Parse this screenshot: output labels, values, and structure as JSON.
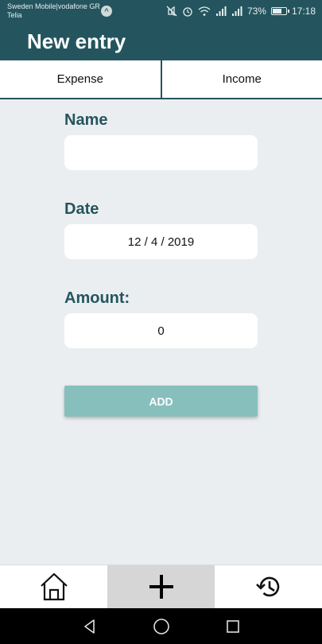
{
  "status_bar": {
    "carrier_line1": "Sweden Mobile|vodafone GR",
    "carrier_line2": "Telia",
    "notification_icon_glyph": "^",
    "battery_percent_label": "73%",
    "battery_level": 0.73,
    "time": "17:18"
  },
  "header": {
    "title": "New entry"
  },
  "tabs": [
    {
      "label": "Expense",
      "active": true
    },
    {
      "label": "Income",
      "active": false
    }
  ],
  "form": {
    "name_label": "Name",
    "name_value": "",
    "date_label": "Date",
    "date_value": "12 / 4 / 2019",
    "amount_label": "Amount:",
    "amount_value": "0",
    "add_button_label": "ADD"
  },
  "bottom_nav": {
    "items": [
      {
        "icon": "home-icon",
        "selected": false
      },
      {
        "icon": "add-icon",
        "selected": true
      },
      {
        "icon": "history-icon",
        "selected": false
      }
    ]
  },
  "system_nav": {
    "buttons": [
      "back-icon",
      "home-circle-icon",
      "recents-icon"
    ]
  },
  "colors": {
    "primary": "#24555e",
    "button": "#86bfbb",
    "background": "#ebeef0"
  }
}
